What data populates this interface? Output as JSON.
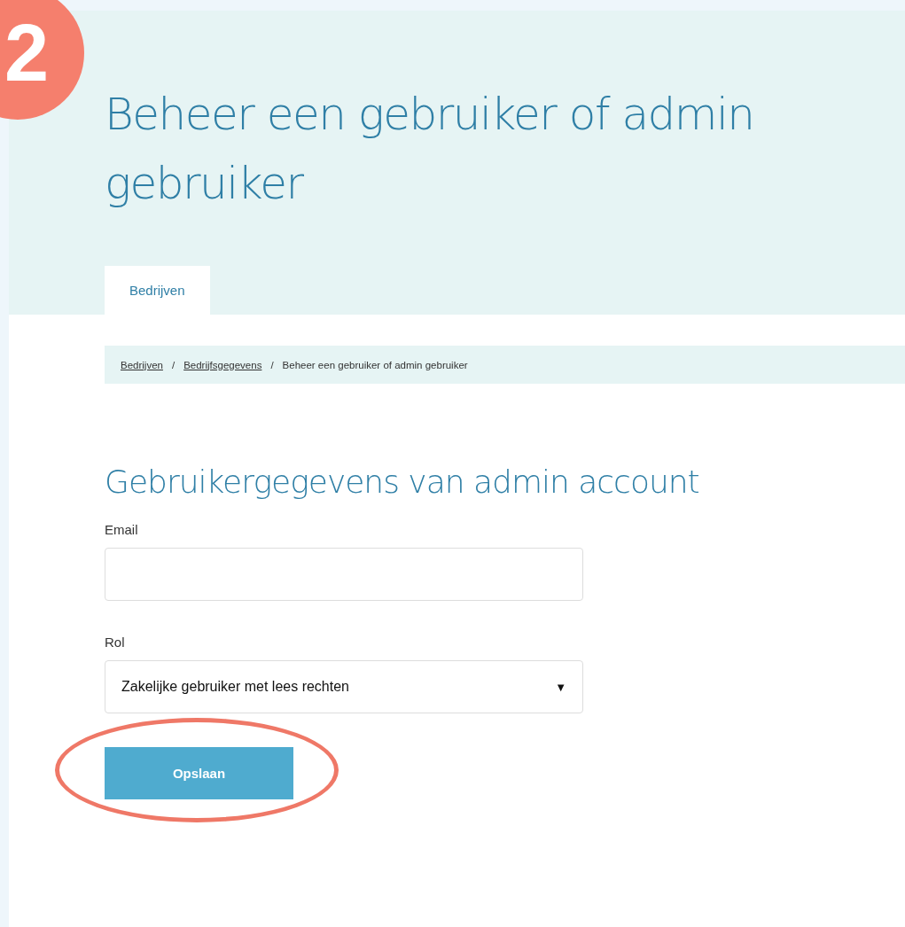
{
  "step_badge": "2",
  "title": "Beheer een gebruiker of admin gebruiker",
  "tabs": [
    {
      "label": "Bedrijven",
      "selected": true
    }
  ],
  "breadcrumb": [
    {
      "label": "Bedrijven",
      "link": true
    },
    {
      "label": "Bedrijfsgegevens",
      "link": true
    },
    {
      "label": "Beheer een gebruiker of admin gebruiker",
      "link": false
    }
  ],
  "separator": "/",
  "section_title": "Gebruikergegevens van admin account",
  "fields": [
    {
      "kind": "text",
      "label": "Email"
    },
    {
      "kind": "select",
      "label": "Rol",
      "value": "Zakelijke gebruiker met lees rechten",
      "caret": "▼"
    }
  ],
  "save_button": {
    "label": "Opslaan",
    "highlighted": true
  }
}
